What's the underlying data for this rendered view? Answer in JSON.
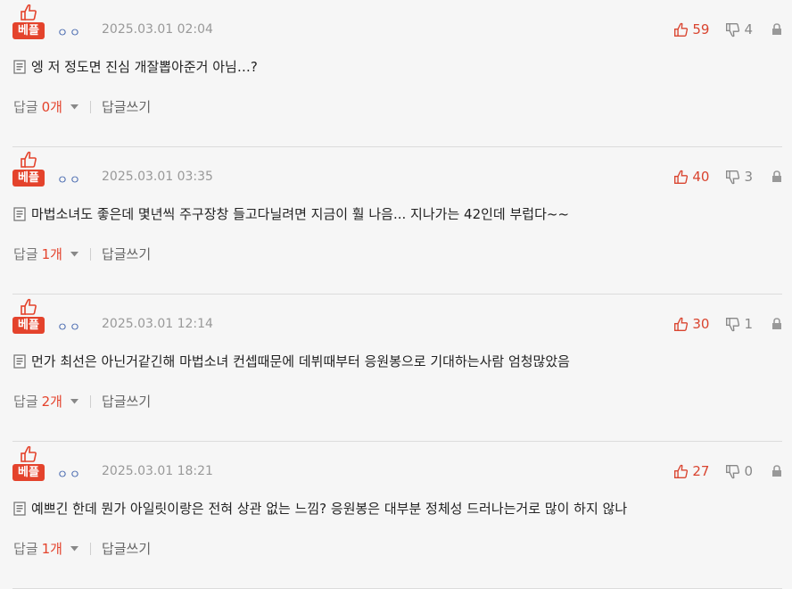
{
  "comments": [
    {
      "badge_label": "베플",
      "author": "ㅇㅇ",
      "date": "2025.03.01 02:04",
      "upvotes": "59",
      "downvotes": "4",
      "text": "엥 저 정도면 진심 개잘뽑아준거 아님…?",
      "reply_label": "답글",
      "reply_count": "0개",
      "write_reply": "답글쓰기"
    },
    {
      "badge_label": "베플",
      "author": "ㅇㅇ",
      "date": "2025.03.01 03:35",
      "upvotes": "40",
      "downvotes": "3",
      "text": "마법소녀도 좋은데 몇년씩 주구장창 들고다닐려면 지금이 훨 나음... 지나가는 42인데 부럽다~~",
      "reply_label": "답글",
      "reply_count": "1개",
      "write_reply": "답글쓰기"
    },
    {
      "badge_label": "베플",
      "author": "ㅇㅇ",
      "date": "2025.03.01 12:14",
      "upvotes": "30",
      "downvotes": "1",
      "text": "먼가 최선은 아닌거같긴해 마법소녀 컨셉때문에 데뷔때부터 응원봉으로 기대하는사람 엄청많았음",
      "reply_label": "답글",
      "reply_count": "2개",
      "write_reply": "답글쓰기"
    },
    {
      "badge_label": "베플",
      "author": "ㅇㅇ",
      "date": "2025.03.01 18:21",
      "upvotes": "27",
      "downvotes": "0",
      "text": "예쁘긴 한데 뭔가 아일릿이랑은 전혀 상관 없는 느낌? 응원봉은 대부분 정체성 드러나는거로 많이 하지 않나",
      "reply_label": "답글",
      "reply_count": "1개",
      "write_reply": "답글쓰기"
    }
  ],
  "colors": {
    "accent": "#e4432c",
    "author": "#4a6bb0",
    "muted": "#999999",
    "divider": "#dcdcdc"
  }
}
